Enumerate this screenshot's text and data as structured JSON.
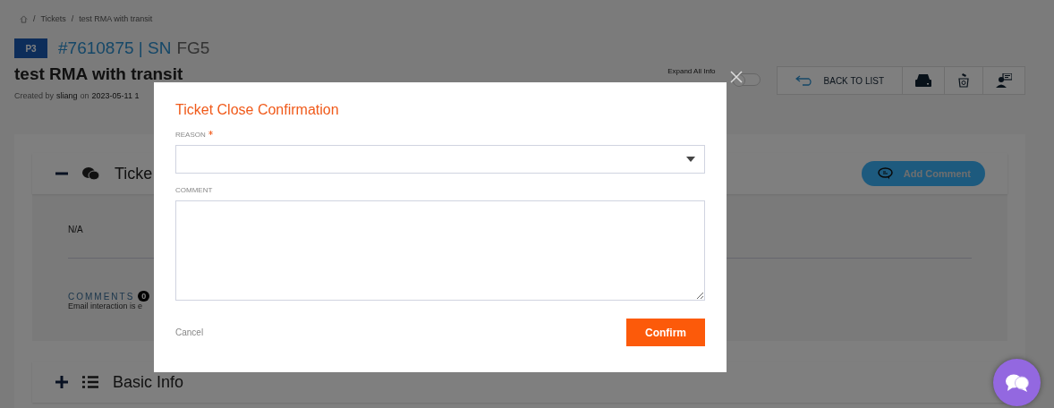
{
  "breadcrumb": {
    "items": [
      {
        "separator": "/",
        "label": "Tickets"
      },
      {
        "separator": "/",
        "label": "test RMA with transit"
      }
    ]
  },
  "ticket": {
    "priority": "P3",
    "number": "#7610875 | SN",
    "serial": "FG5",
    "title": "test RMA with transit",
    "created_prefix": "Created by",
    "author": "sliang",
    "created_on": "on",
    "created_date": "2023-05-11 1"
  },
  "toolbar": {
    "expand_label": "Expand All Info",
    "expand_on": false,
    "back_button": "BACK TO LIST"
  },
  "ticket_card": {
    "expanded": true,
    "title": "Ticke",
    "add_comment": "Add Comment",
    "value": "N/A",
    "comments_label": "COMMENTS",
    "comments_count": "0",
    "note": "Email interaction is e"
  },
  "basic_info_card": {
    "expanded": false,
    "title": "Basic Info"
  },
  "dialog": {
    "title": "Ticket Close Confirmation",
    "fields": [
      {
        "kind": "select",
        "label": "REASON",
        "required": true
      },
      {
        "kind": "textarea",
        "label": "COMMENT",
        "required": false
      }
    ],
    "cancel": "Cancel",
    "confirm": "Confirm"
  }
}
